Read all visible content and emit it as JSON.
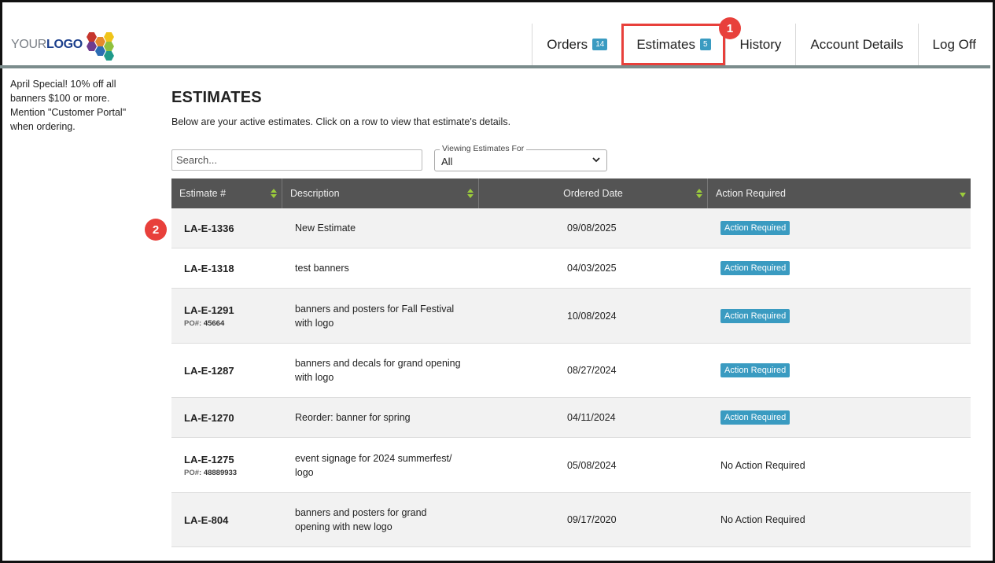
{
  "brand": {
    "logo_your": "YOUR",
    "logo_logo": "LOGO",
    "colors": {
      "accent": "#3a9bc1",
      "header_bar": "#7b8c8c",
      "table_header": "#545454",
      "annotation": "#e8403b"
    }
  },
  "nav": {
    "items": [
      {
        "label": "Orders",
        "badge": "14"
      },
      {
        "label": "Estimates",
        "badge": "5"
      },
      {
        "label": "History"
      },
      {
        "label": "Account Details"
      },
      {
        "label": "Log Off"
      }
    ]
  },
  "annotations": {
    "marker1": "1",
    "marker2": "2"
  },
  "sidebar": {
    "promo": "April Special! 10% off all banners $100 or more. Mention \"Customer Portal\" when ordering."
  },
  "main": {
    "title": "ESTIMATES",
    "intro": "Below are your active estimates. Click on a row to view that estimate's details.",
    "search_placeholder": "Search...",
    "filter": {
      "legend": "Viewing Estimates For",
      "value": "All"
    }
  },
  "table": {
    "columns": [
      "Estimate #",
      "Description",
      "Ordered Date",
      "Action Required"
    ],
    "rows": [
      {
        "estimate": "LA-E-1336",
        "po_label": "",
        "po": "",
        "description": "New Estimate",
        "date": "09/08/2025",
        "action": "Action Required"
      },
      {
        "estimate": "LA-E-1318",
        "po_label": "",
        "po": "",
        "description": "test banners",
        "date": "04/03/2025",
        "action": "Action Required"
      },
      {
        "estimate": "LA-E-1291",
        "po_label": "PO#:",
        "po": "45664",
        "description": "banners and posters for Fall Festival with logo",
        "date": "10/08/2024",
        "action": "Action Required"
      },
      {
        "estimate": "LA-E-1287",
        "po_label": "",
        "po": "",
        "description": "banners and decals for grand opening with logo",
        "date": "08/27/2024",
        "action": "Action Required"
      },
      {
        "estimate": "LA-E-1270",
        "po_label": "",
        "po": "",
        "description": "Reorder: banner for spring",
        "date": "04/11/2024",
        "action": "Action Required"
      },
      {
        "estimate": "LA-E-1275",
        "po_label": "PO#:",
        "po": "48889933",
        "description": "event signage for 2024 summerfest/ logo",
        "date": "05/08/2024",
        "action": "No Action Required"
      },
      {
        "estimate": "LA-E-804",
        "po_label": "",
        "po": "",
        "description": "banners and posters for grand opening with new logo",
        "date": "09/17/2020",
        "action": "No Action Required"
      }
    ]
  }
}
